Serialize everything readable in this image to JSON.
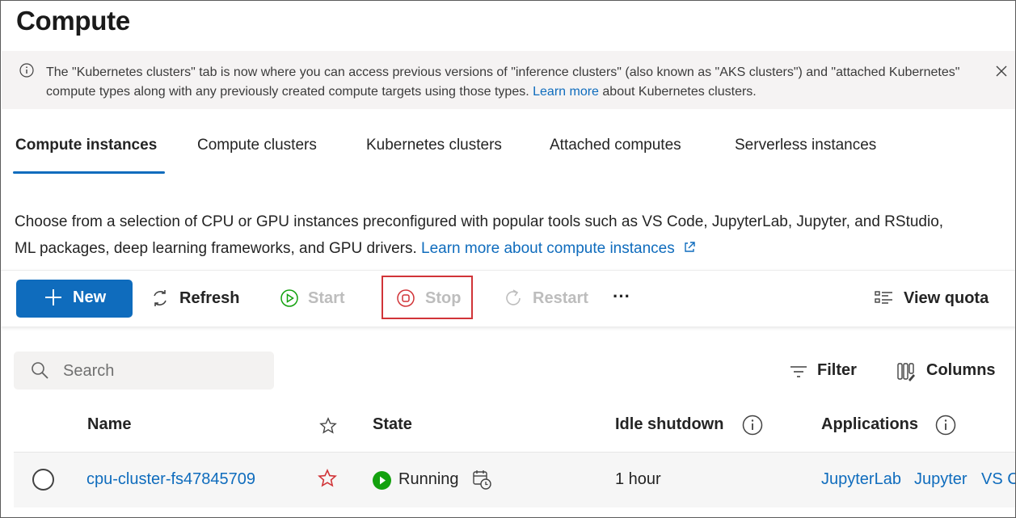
{
  "page": {
    "title": "Compute"
  },
  "banner": {
    "text_before": "The \"Kubernetes clusters\" tab is now where you can access previous versions of \"inference clusters\" (also known as \"AKS clusters\") and \"attached Kubernetes\" compute types along with any previously created compute targets using those types.",
    "link": "Learn more",
    "text_after": "about Kubernetes clusters."
  },
  "tabs": [
    {
      "label": "Compute instances",
      "active": true
    },
    {
      "label": "Compute clusters",
      "active": false
    },
    {
      "label": "Kubernetes clusters",
      "active": false
    },
    {
      "label": "Attached computes",
      "active": false
    },
    {
      "label": "Serverless instances",
      "active": false
    }
  ],
  "description": {
    "line1": "Choose from a selection of CPU or GPU instances preconfigured with popular tools such as VS Code, JupyterLab, Jupyter, and RStudio,",
    "line2": "ML packages, deep learning frameworks, and GPU drivers.",
    "link": "Learn more about compute instances"
  },
  "toolbar": {
    "new_label": "New",
    "refresh_label": "Refresh",
    "start_label": "Start",
    "stop_label": "Stop",
    "restart_label": "Restart",
    "more_label": "···",
    "view_quota_label": "View quota"
  },
  "grid": {
    "search_placeholder": "Search",
    "filter_label": "Filter",
    "columns_label": "Columns",
    "headers": {
      "name": "Name",
      "state": "State",
      "idle_shutdown": "Idle shutdown",
      "applications": "Applications"
    },
    "rows": [
      {
        "name": "cpu-cluster-fs47845709",
        "state": "Running",
        "idle_shutdown": "1 hour",
        "applications": [
          "JupyterLab",
          "Jupyter",
          "VS Code"
        ]
      }
    ]
  },
  "colors": {
    "accent": "#0f6cbd",
    "running": "#13a10e",
    "favorite": "#d13438",
    "highlight": "#d13438"
  }
}
